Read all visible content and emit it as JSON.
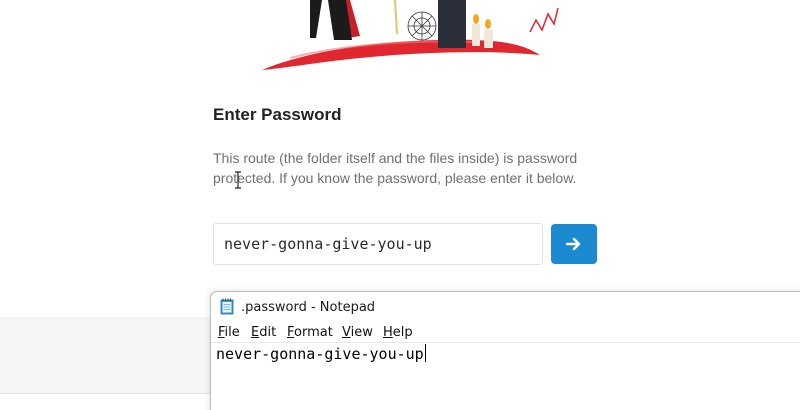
{
  "password_page": {
    "title": "Enter Password",
    "description": "This route (the folder itself and the files inside) is password protected. If you know the password, please enter it below.",
    "input_value": "never-gonna-give-you-up",
    "submit_icon": "arrow-right-icon"
  },
  "notepad": {
    "window_title": ".password - Notepad",
    "icon": "notepad-icon",
    "menu": [
      {
        "mnemonic": "F",
        "rest": "ile"
      },
      {
        "mnemonic": "E",
        "rest": "dit"
      },
      {
        "mnemonic": "F",
        "rest": "ormat"
      },
      {
        "mnemonic": "V",
        "rest": "iew"
      },
      {
        "mnemonic": "H",
        "rest": "elp"
      }
    ],
    "content": "never-gonna-give-you-up"
  },
  "colors": {
    "accent": "#1c8ad0",
    "title_text": "#222222",
    "description_text": "#707070",
    "illustration_red": "#e0262f"
  }
}
